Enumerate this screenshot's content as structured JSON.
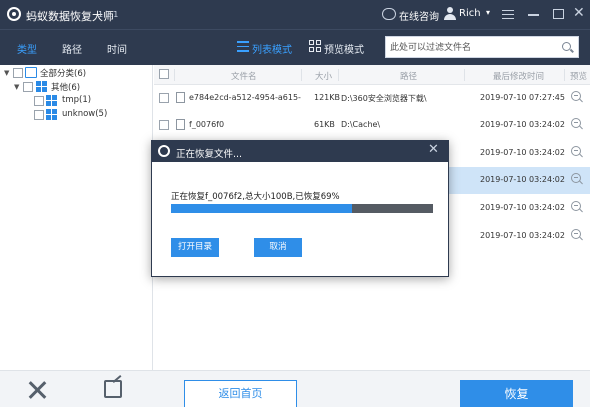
{
  "title_bar": {
    "app_name": "蚂蚁数据恢复大师",
    "version": "1.1.1",
    "online_consult": "在线咨询",
    "user_name": "Rich"
  },
  "toolbar": {
    "tabs": [
      {
        "label": "类型",
        "active": true
      },
      {
        "label": "路径",
        "active": false
      },
      {
        "label": "时间",
        "active": false
      }
    ],
    "list_mode": "列表模式",
    "preview_mode": "预览模式",
    "search_placeholder": "此处可以过滤文件名",
    "accent_color": "#3aa0ff"
  },
  "tree": [
    {
      "label": "全部分类(6)",
      "level": 0,
      "icon": "monitor-icon"
    },
    {
      "label": "其他(6)",
      "level": 1,
      "icon": "windows-icon"
    },
    {
      "label": "tmp(1)",
      "level": 2,
      "icon": "windows-icon"
    },
    {
      "label": "unknow(5)",
      "level": 2,
      "icon": "windows-icon"
    }
  ],
  "table": {
    "columns": [
      "文件名",
      "大小",
      "路径",
      "最后修改时间",
      "预览"
    ],
    "rows": [
      {
        "name": "e784e2cd-a512-4954-a615-b640",
        "size": "121KB",
        "path": "D:\\360安全浏览器下载\\",
        "time": "2019-07-10 07:27:45"
      },
      {
        "name": "f_0076f0",
        "size": "61KB",
        "path": "D:\\Cache\\",
        "time": "2019-07-10 03:24:02"
      },
      {
        "name": "",
        "size": "",
        "path": "",
        "time": "2019-07-10 03:24:02"
      },
      {
        "name": "",
        "size": "",
        "path": "",
        "time": "2019-07-10 03:24:02"
      },
      {
        "name": "",
        "size": "",
        "path": "",
        "time": "2019-07-10 03:24:02"
      },
      {
        "name": "",
        "size": "",
        "path": "",
        "time": "2019-07-10 03:24:02"
      }
    ]
  },
  "bottom_bar": {
    "home_button": "返回首页",
    "recover_button": "恢复",
    "primary_color": "#2f8ee8"
  },
  "dialog": {
    "title": "正在恢复文件...",
    "status": "正在恢复f_0076f2,总大小100B,已恢复69%",
    "progress_percent": 69,
    "open_dir_button": "打开目录",
    "cancel_button": "取消"
  }
}
